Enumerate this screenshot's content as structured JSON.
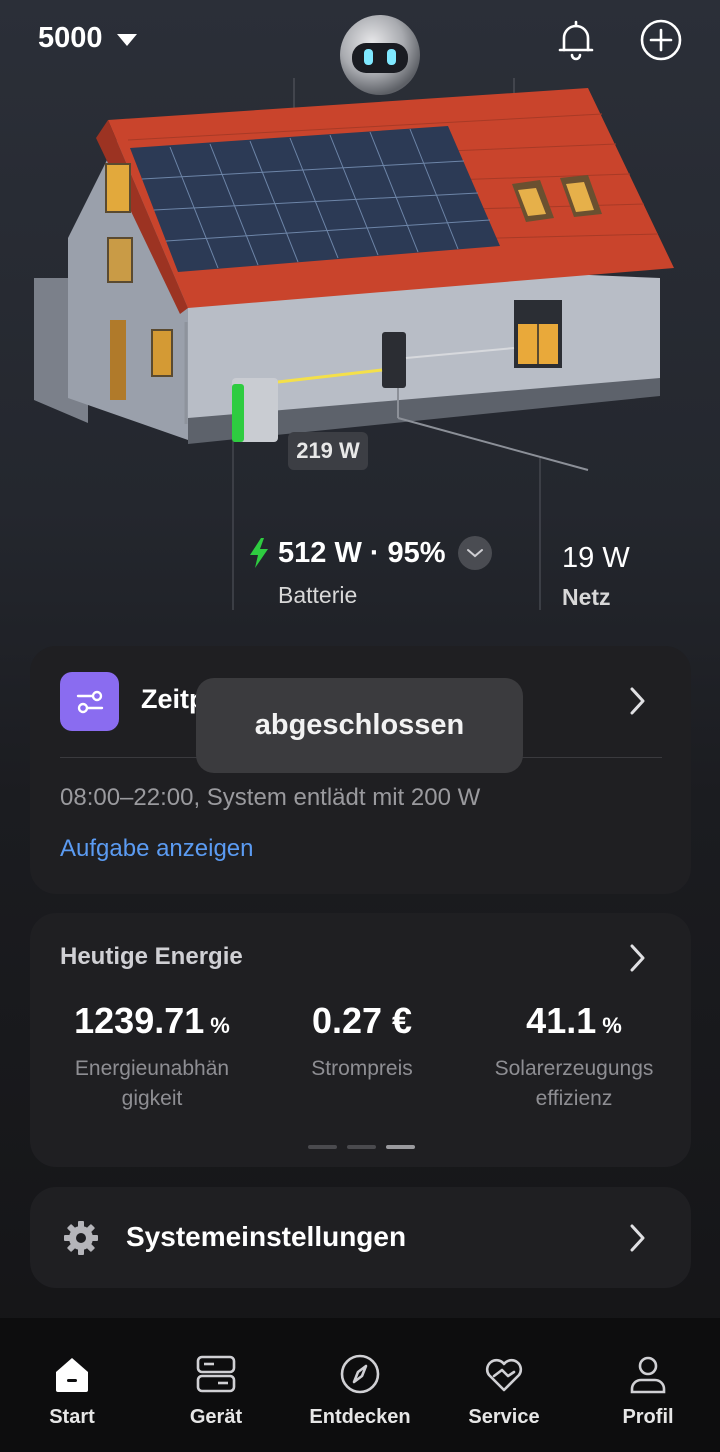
{
  "header": {
    "device_name": "5000",
    "icons": [
      "chevron-down-icon",
      "robot-avatar-icon",
      "bell-icon",
      "plus-circle-icon"
    ]
  },
  "energy_flow": {
    "pv_power": "219 W",
    "battery_power": "512 W",
    "battery_separator": "·",
    "battery_soc": "95%",
    "battery_label": "Batterie",
    "grid_power": "19 W",
    "grid_label": "Netz"
  },
  "schedule_card": {
    "title": "Zeitplan",
    "description": "08:00–22:00, System entlädt mit 200 W",
    "link": "Aufgabe anzeigen"
  },
  "toast": {
    "message": "abgeschlossen"
  },
  "energy_card": {
    "title": "Heutige Energie",
    "stats": [
      {
        "value": "1239.71",
        "unit": "%",
        "label_line1": "Energieunabhän",
        "label_line2": "gigkeit"
      },
      {
        "value": "0.27 €",
        "unit": "",
        "label_line1": "Strompreis",
        "label_line2": ""
      },
      {
        "value": "41.1",
        "unit": "%",
        "label_line1": "Solarerzeugungs",
        "label_line2": "effizienz"
      }
    ],
    "page_count": 3,
    "active_page": 3
  },
  "settings_card": {
    "title": "Systemeinstellungen"
  },
  "bottom_nav": [
    {
      "label": "Start",
      "icon": "home-icon",
      "active": true
    },
    {
      "label": "Gerät",
      "icon": "device-icon",
      "active": false
    },
    {
      "label": "Entdecken",
      "icon": "compass-icon",
      "active": false
    },
    {
      "label": "Service",
      "icon": "service-heart-icon",
      "active": false
    },
    {
      "label": "Profil",
      "icon": "profile-icon",
      "active": false
    }
  ],
  "colors": {
    "accent_green": "#2ecc40",
    "link_blue": "#5b9bf2",
    "schedule_purple": "#8a6cf0"
  }
}
